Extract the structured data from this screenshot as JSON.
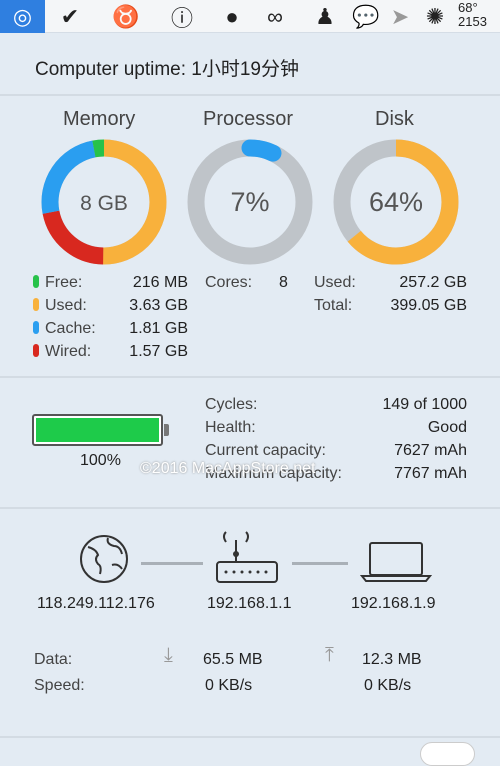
{
  "menubar": {
    "icons": [
      "istat-gauge-icon",
      "acorn-check-icon",
      "cow-icon",
      "1password-icon",
      "clock-icon",
      "circles-check-icon",
      "qq-penguin-icon",
      "wechat-icon",
      "paper-plane-icon",
      "fan-icon"
    ],
    "temperature": "68°",
    "fan_rpm": "2153",
    "accent": "#2f7fe0"
  },
  "uptime": {
    "label": "Computer uptime: 1小时19分钟"
  },
  "memory": {
    "title": "Memory",
    "center": "8 GB",
    "items": [
      {
        "label": "Free:",
        "value": "216 MB",
        "color": "#27c24a",
        "gb": 0.216
      },
      {
        "label": "Used:",
        "value": "3.63 GB",
        "color": "#f8b13c",
        "gb": 3.63
      },
      {
        "label": "Cache:",
        "value": "1.81 GB",
        "color": "#2a9ef0",
        "gb": 1.81
      },
      {
        "label": "Wired:",
        "value": "1.57 GB",
        "color": "#d8281f",
        "gb": 1.57
      }
    ]
  },
  "processor": {
    "title": "Processor",
    "center": "7%",
    "percent": 7,
    "cores_label": "Cores:",
    "cores": "8",
    "color": "#2a9ef0"
  },
  "disk": {
    "title": "Disk",
    "center": "64%",
    "percent": 64,
    "used_label": "Used:",
    "used": "257.2 GB",
    "total_label": "Total:",
    "total": "399.05 GB",
    "color": "#f8b13c"
  },
  "battery": {
    "percent_label": "100%",
    "percent": 100,
    "color": "#1ecb4a",
    "rows": [
      {
        "label": "Cycles:",
        "value": "149 of 1000"
      },
      {
        "label": "Health:",
        "value": "Good"
      },
      {
        "label": "Current capacity:",
        "value": "7627 mAh"
      },
      {
        "label": "Maximum capacity:",
        "value": "7767 mAh"
      }
    ]
  },
  "watermark": "©2016 MacAppStore.net",
  "network": {
    "public_ip": "118.249.112.176",
    "router_ip": "192.168.1.1",
    "local_ip": "192.168.1.9",
    "data_label": "Data:",
    "speed_label": "Speed:",
    "download": "65.5 MB",
    "upload": "12.3 MB",
    "down_speed": "0 KB/s",
    "up_speed": "0 KB/s"
  }
}
